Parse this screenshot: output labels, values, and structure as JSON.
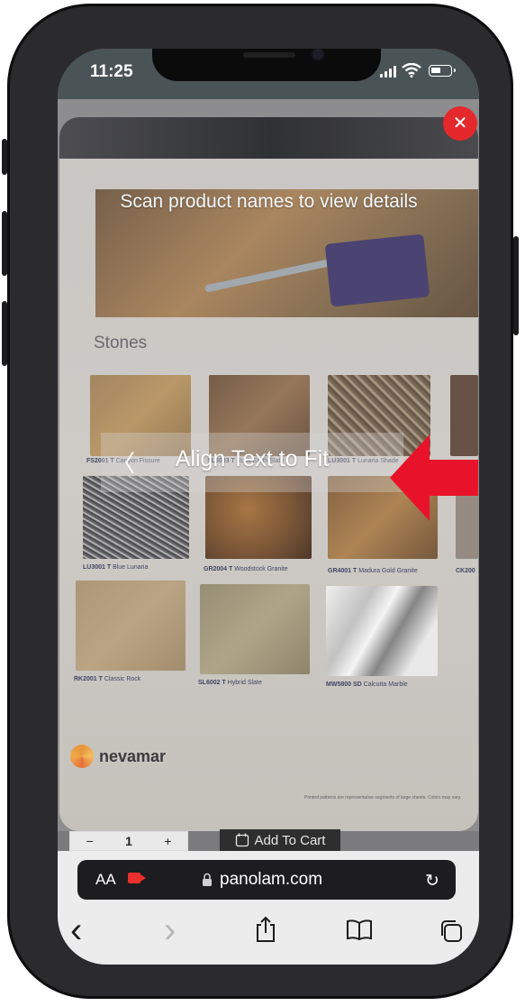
{
  "status_bar": {
    "time": "11:25"
  },
  "scan_overlay": {
    "hint": "Scan product names to view details",
    "align_label": "Align Text to Fit",
    "back_glyph": "〈",
    "close_glyph": "✕",
    "close_color": "#e4282b",
    "arrow_color": "#e8132a"
  },
  "catalog": {
    "section_title": "Stones",
    "brand": "nevamar",
    "fine_print": "Printed patterns are representative segments of large sheets. Colors may vary.",
    "swatches": [
      {
        "code": "FS2001 T",
        "name": "Canyon Fissure"
      },
      {
        "code": "SL6003 T",
        "name": "Rock Earth Slate"
      },
      {
        "code": "LU3001 T",
        "name": "Lunaria Shade"
      },
      {
        "code": "LU3001 T",
        "name": "Blue Lunaria"
      },
      {
        "code": "GR2004 T",
        "name": "Woodstock Granite"
      },
      {
        "code": "GR4001 T",
        "name": "Madura Gold Granite"
      },
      {
        "code": "CK200",
        "name": ""
      },
      {
        "code": "RK2001 T",
        "name": "Classic Rock"
      },
      {
        "code": "SL6002 T",
        "name": "Hybrid Slate"
      },
      {
        "code": "MW5800 SD",
        "name": "Calcutta Marble"
      }
    ]
  },
  "page_behind": {
    "minus": "−",
    "quantity": "1",
    "plus": "+",
    "add_to_cart": "Add To Cart"
  },
  "browser": {
    "aa_label": "AA",
    "url": "panolam.com",
    "reload_glyph": "↻",
    "back_glyph": "‹",
    "forward_glyph": "›"
  }
}
